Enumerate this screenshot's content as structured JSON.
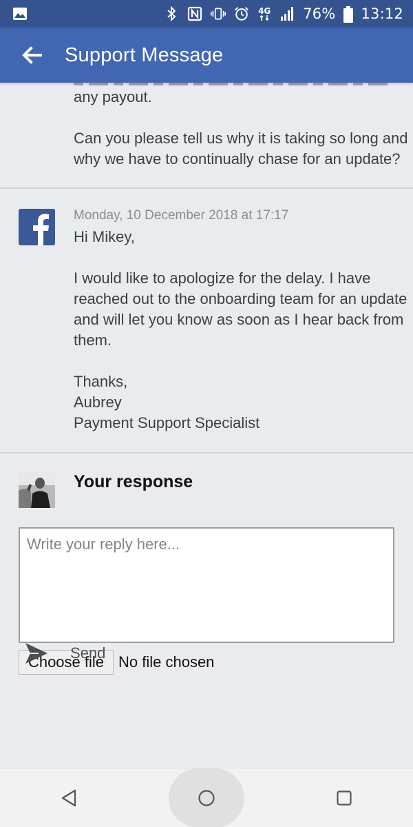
{
  "status_bar": {
    "network_label": "4G",
    "battery_percent": "76%",
    "time": "13:12",
    "icons": [
      "image-icon",
      "bluetooth-icon",
      "nfc-icon",
      "vibrate-icon",
      "alarm-icon",
      "network-4g-icon",
      "signal-icon",
      "battery-icon"
    ]
  },
  "app_bar": {
    "title": "Support Message",
    "back_icon": "arrow-left-icon"
  },
  "first_message": {
    "text": "any payout.\n\nCan you please tell us why it is taking so long and why we have to continually chase for an update?"
  },
  "second_message": {
    "sender_icon": "facebook-logo-icon",
    "date": "Monday, 10 December 2018 at 17:17",
    "greeting": "Hi Mikey,",
    "body": "I would like to apologize for the delay. I have reached out to the onboarding team for an update and will let you know as soon as I hear back from them.",
    "signoff": "Thanks,\nAubrey\nPayment Support Specialist"
  },
  "response": {
    "title": "Your response",
    "reply_placeholder": "Write your reply here...",
    "file_button_label": "Choose file",
    "file_status": "No file chosen",
    "send_label": "Send"
  },
  "nav_bar": {
    "buttons": [
      "back-triangle-icon",
      "home-circle-icon",
      "recents-square-icon"
    ]
  },
  "colors": {
    "status_bar": "#35538f",
    "app_bar": "#4267b2",
    "background": "#e9ebee",
    "facebook_blue": "#3b5998"
  }
}
